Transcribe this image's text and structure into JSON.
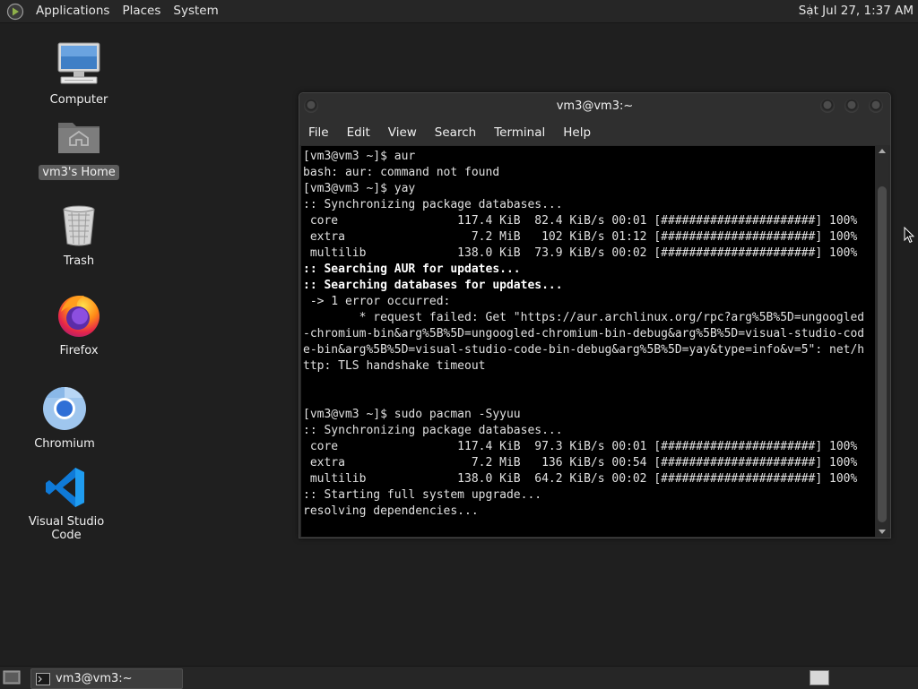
{
  "top_panel": {
    "menus": [
      "Applications",
      "Places",
      "System"
    ],
    "clock": "Sat Jul 27,  1:37 AM"
  },
  "desktop": {
    "icons": [
      {
        "label": "Computer",
        "icon": "computer-icon",
        "selected": false
      },
      {
        "label": "vm3's Home",
        "icon": "home-folder-icon",
        "selected": true
      },
      {
        "label": "Trash",
        "icon": "trash-icon",
        "selected": false
      },
      {
        "label": "Firefox",
        "icon": "firefox-icon",
        "selected": false
      },
      {
        "label": "Chromium",
        "icon": "chromium-icon",
        "selected": false
      },
      {
        "label": "Visual Studio Code",
        "icon": "vscode-icon",
        "selected": false
      }
    ]
  },
  "terminal": {
    "title": "vm3@vm3:~",
    "menu": [
      "File",
      "Edit",
      "View",
      "Search",
      "Terminal",
      "Help"
    ],
    "lines": [
      {
        "text": "[vm3@vm3 ~]$ aur",
        "bold": false
      },
      {
        "text": "bash: aur: command not found",
        "bold": false
      },
      {
        "text": "[vm3@vm3 ~]$ yay",
        "bold": false
      },
      {
        "text": ":: Synchronizing package databases...",
        "bold": false
      },
      {
        "text": " core                 117.4 KiB  82.4 KiB/s 00:01 [######################] 100%",
        "bold": false
      },
      {
        "text": " extra                  7.2 MiB   102 KiB/s 01:12 [######################] 100%",
        "bold": false
      },
      {
        "text": " multilib             138.0 KiB  73.9 KiB/s 00:02 [######################] 100%",
        "bold": false
      },
      {
        "text": ":: Searching AUR for updates...",
        "bold": true
      },
      {
        "text": ":: Searching databases for updates...",
        "bold": true
      },
      {
        "text": " -> 1 error occurred:",
        "bold": false
      },
      {
        "text": "        * request failed: Get \"https://aur.archlinux.org/rpc?arg%5B%5D=ungoogled",
        "bold": false
      },
      {
        "text": "-chromium-bin&arg%5B%5D=ungoogled-chromium-bin-debug&arg%5B%5D=visual-studio-cod",
        "bold": false
      },
      {
        "text": "e-bin&arg%5B%5D=visual-studio-code-bin-debug&arg%5B%5D=yay&type=info&v=5\": net/h",
        "bold": false
      },
      {
        "text": "ttp: TLS handshake timeout",
        "bold": false
      },
      {
        "text": "",
        "bold": false
      },
      {
        "text": "",
        "bold": false
      },
      {
        "text": "[vm3@vm3 ~]$ sudo pacman -Syyuu",
        "bold": false
      },
      {
        "text": ":: Synchronizing package databases...",
        "bold": false
      },
      {
        "text": " core                 117.4 KiB  97.3 KiB/s 00:01 [######################] 100%",
        "bold": false
      },
      {
        "text": " extra                  7.2 MiB   136 KiB/s 00:54 [######################] 100%",
        "bold": false
      },
      {
        "text": " multilib             138.0 KiB  64.2 KiB/s 00:02 [######################] 100%",
        "bold": false
      },
      {
        "text": ":: Starting full system upgrade...",
        "bold": false
      },
      {
        "text": "resolving dependencies...",
        "bold": false
      }
    ]
  },
  "taskbar": {
    "task_label": "vm3@vm3:~"
  }
}
